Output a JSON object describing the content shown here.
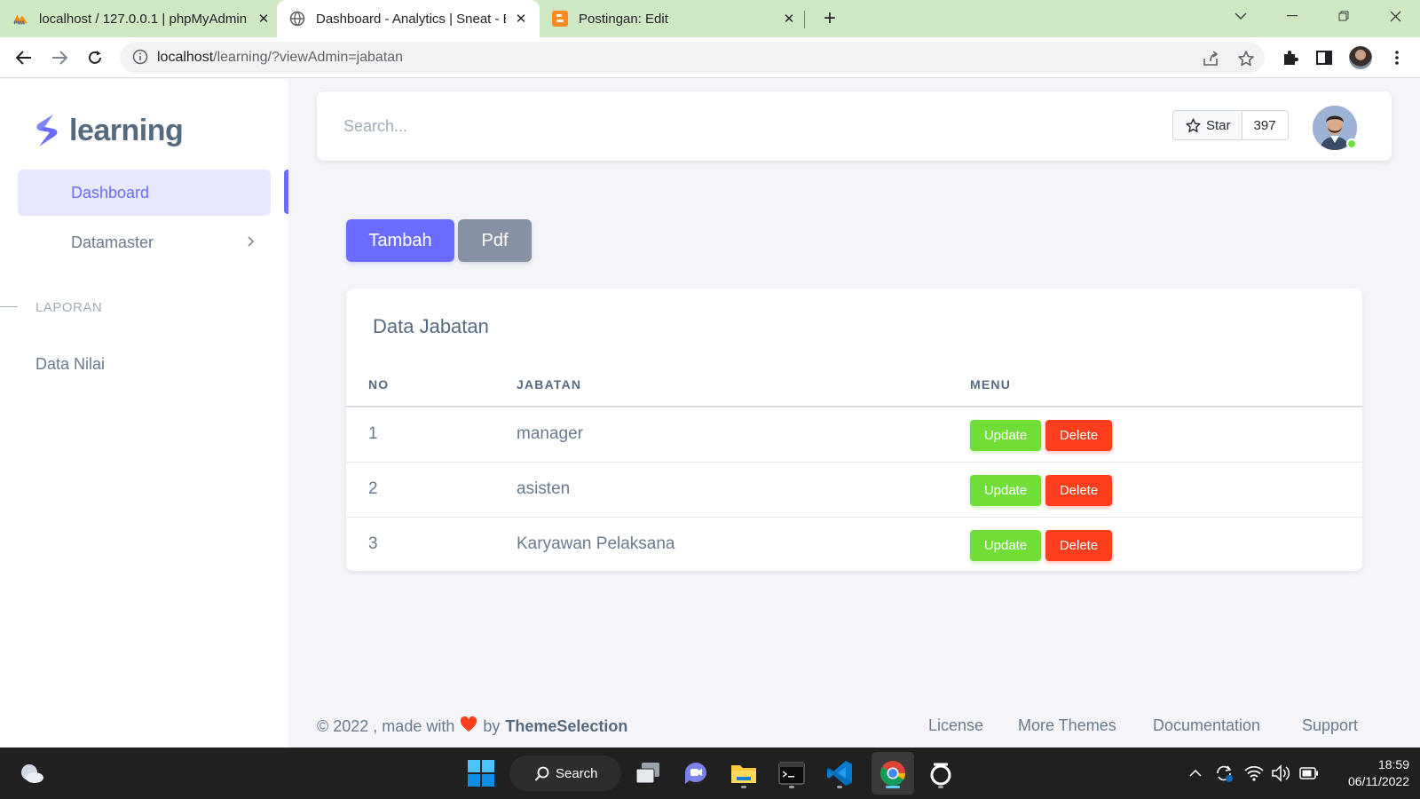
{
  "browser": {
    "tabs": [
      {
        "title": "localhost / 127.0.0.1 | phpMyAdmin",
        "icon": "phpmyadmin-icon"
      },
      {
        "title": "Dashboard - Analytics | Sneat - Bootstrap",
        "icon": "globe-icon",
        "active": true
      },
      {
        "title": "Postingan: Edit",
        "icon": "blogger-icon"
      }
    ],
    "url_host": "localhost",
    "url_path": "/learning/?viewAdmin=jabatan"
  },
  "sidebar": {
    "brand": "learning",
    "items": [
      {
        "label": "Dashboard",
        "active": true
      },
      {
        "label": "Datamaster"
      }
    ],
    "section_header": "LAPORAN",
    "section_items": [
      {
        "label": "Data Nilai"
      }
    ]
  },
  "navbar": {
    "search_placeholder": "Search...",
    "star_label": "Star",
    "star_count": "397"
  },
  "actions": {
    "tambah_label": "Tambah",
    "pdf_label": "Pdf"
  },
  "card": {
    "title": "Data Jabatan",
    "columns": [
      "NO",
      "JABATAN",
      "MENU"
    ],
    "rows": [
      {
        "no": "1",
        "jabatan": "manager",
        "update": "Update",
        "delete": "Delete"
      },
      {
        "no": "2",
        "jabatan": "asisten",
        "update": "Update",
        "delete": "Delete"
      },
      {
        "no": "3",
        "jabatan": "Karyawan Pelaksana",
        "update": "Update",
        "delete": "Delete"
      }
    ]
  },
  "footer": {
    "copyright": "© 2022 , made with",
    "by": "by",
    "theme": "ThemeSelection",
    "links": [
      "License",
      "More Themes",
      "Documentation",
      "Support"
    ]
  },
  "taskbar": {
    "search_label": "Search",
    "time": "18:59",
    "date": "06/11/2022"
  },
  "colors": {
    "primary": "#696cff",
    "secondary": "#8592a3",
    "success": "#71dd37",
    "danger": "#ff3e1d",
    "tab_bar": "#cfe8c4"
  }
}
